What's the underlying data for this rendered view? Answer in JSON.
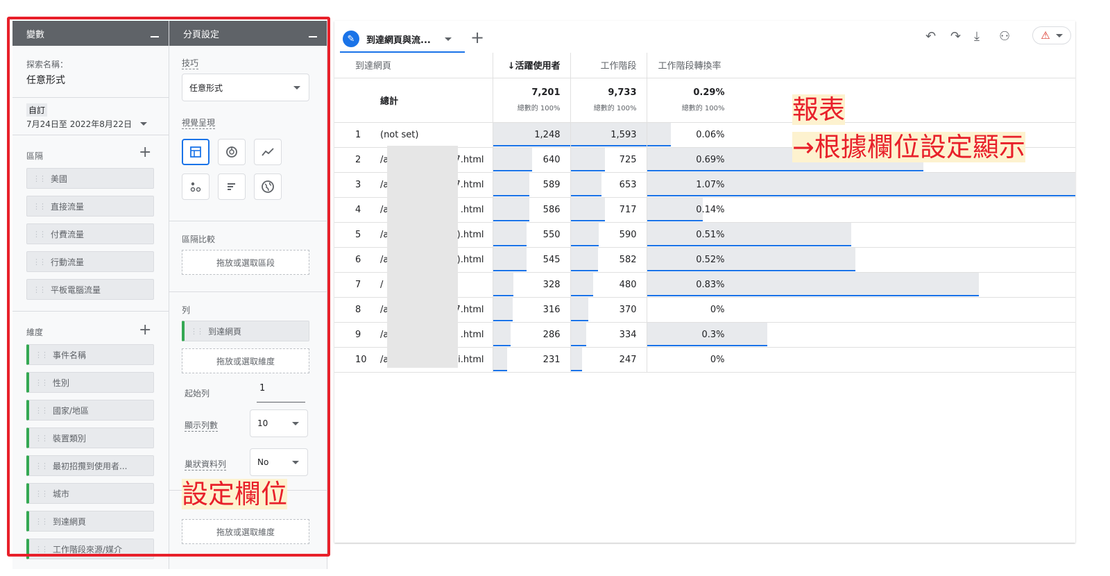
{
  "variables_panel": {
    "title": "變數",
    "exploration_name_label": "探索名稱：",
    "exploration_name": "任意形式",
    "date_label": "自訂",
    "date_range": "7月24日至 2022年8月22日",
    "segments_label": "區隔",
    "segments": [
      "美國",
      "直接流量",
      "付費流量",
      "行動流量",
      "平板電腦流量"
    ],
    "dimensions_label": "維度",
    "dimensions": [
      "事件名稱",
      "性別",
      "國家/地區",
      "裝置類別",
      "最初招攬到使用者...",
      "城市",
      "到達網頁",
      "工作階段來源/媒介"
    ]
  },
  "tab_settings_panel": {
    "title": "分頁設定",
    "technique_label": "技巧",
    "technique_value": "任意形式",
    "visualization_label": "視覺呈現",
    "visualization_icons": [
      "table-icon",
      "donut-icon",
      "line-chart-icon",
      "scatter-icon",
      "bar-chart-icon",
      "globe-icon"
    ],
    "segment_compare_label": "區隔比較",
    "drop_segment_hint": "拖放或選取區段",
    "rows_label": "列",
    "row_dimension": "到達網頁",
    "drop_dimension_hint": "拖放或選取維度",
    "start_row_label": "起始列",
    "start_row_value": "1",
    "show_rows_label": "顯示列數",
    "show_rows_value": "10",
    "nested_rows_label": "巢狀資料列",
    "nested_rows_value": "No",
    "drop_dimension_hint_2": "拖放或選取維度"
  },
  "annotations": {
    "settings": "設定欄位",
    "report_title": "報表",
    "report_sub": "→根據欄位設定顯示"
  },
  "report": {
    "tab_label": "到達網頁與流...",
    "add_tab": "+",
    "toolbar_icons": [
      "undo-icon",
      "redo-icon",
      "download-icon",
      "share-icon",
      "warning-icon"
    ],
    "columns": [
      "到達網頁",
      "↓活躍使用者",
      "工作階段",
      "工作階段轉換率"
    ],
    "totals": {
      "label": "總計",
      "active_users": "7,201",
      "active_users_sub": "總數的 100%",
      "sessions": "9,733",
      "sessions_sub": "總數的 100%",
      "conv_rate": "0.29%",
      "conv_rate_sub": "總數的 100%"
    },
    "rows": [
      {
        "n": "1",
        "page": "(not set)",
        "users": "1,248",
        "sessions": "1,593",
        "rate": "0.06%",
        "users_v": 1248,
        "sessions_v": 1593,
        "rate_v": 0.06
      },
      {
        "n": "2",
        "page": "/a",
        "page_end": "7.html",
        "users": "640",
        "sessions": "725",
        "rate": "0.69%",
        "users_v": 640,
        "sessions_v": 725,
        "rate_v": 0.69
      },
      {
        "n": "3",
        "page": "/a",
        "page_end": "7.html",
        "users": "589",
        "sessions": "653",
        "rate": "1.07%",
        "users_v": 589,
        "sessions_v": 653,
        "rate_v": 1.07
      },
      {
        "n": "4",
        "page": "/a",
        "page_end": ".html",
        "users": "586",
        "sessions": "717",
        "rate": "0.14%",
        "users_v": 586,
        "sessions_v": 717,
        "rate_v": 0.14
      },
      {
        "n": "5",
        "page": "/a",
        "page_end": ").html",
        "users": "550",
        "sessions": "590",
        "rate": "0.51%",
        "users_v": 550,
        "sessions_v": 590,
        "rate_v": 0.51
      },
      {
        "n": "6",
        "page": "/a",
        "page_end": ").html",
        "users": "545",
        "sessions": "582",
        "rate": "0.52%",
        "users_v": 545,
        "sessions_v": 582,
        "rate_v": 0.52
      },
      {
        "n": "7",
        "page": "/",
        "page_end": "",
        "users": "328",
        "sessions": "480",
        "rate": "0.83%",
        "users_v": 328,
        "sessions_v": 480,
        "rate_v": 0.83
      },
      {
        "n": "8",
        "page": "/a",
        "page_end": "7.html",
        "users": "316",
        "sessions": "370",
        "rate": "0%",
        "users_v": 316,
        "sessions_v": 370,
        "rate_v": 0
      },
      {
        "n": "9",
        "page": "/a",
        "page_end": ".html",
        "users": "286",
        "sessions": "334",
        "rate": "0.3%",
        "users_v": 286,
        "sessions_v": 334,
        "rate_v": 0.3
      },
      {
        "n": "10",
        "page": "/a",
        "page_end": "i.html",
        "users": "231",
        "sessions": "247",
        "rate": "0%",
        "users_v": 231,
        "sessions_v": 247,
        "rate_v": 0
      }
    ]
  },
  "colors": {
    "accent": "#1a73e8",
    "annotation": "#e8202a",
    "chip_green": "#34a853"
  }
}
